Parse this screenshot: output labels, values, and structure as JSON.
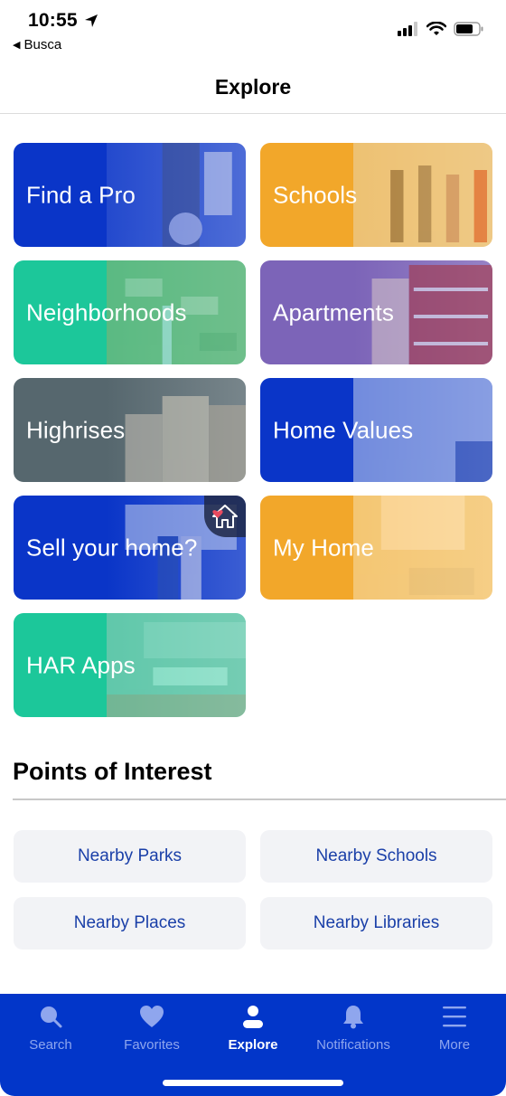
{
  "status_bar": {
    "time": "10:55",
    "back_app": "Busca",
    "icons": [
      "location-arrow-icon",
      "signal-icon",
      "wifi-icon",
      "battery-icon"
    ]
  },
  "header": {
    "title": "Explore"
  },
  "tiles": [
    {
      "label": "Find a Pro",
      "icon": "handshake-image",
      "color": "#0a35c8"
    },
    {
      "label": "Schools",
      "icon": "students-image",
      "color": "#f2a72a"
    },
    {
      "label": "Neighborhoods",
      "icon": "aerial-neighborhood-image",
      "color": "#1cc79a"
    },
    {
      "label": "Apartments",
      "icon": "apartment-building-image",
      "color": "#7c64b8"
    },
    {
      "label": "Highrises",
      "icon": "highrise-building-image",
      "color": "#56676e"
    },
    {
      "label": "Home Values",
      "icon": "paperwork-image",
      "color": "#0a35c8"
    },
    {
      "label": "Sell your home?",
      "icon": "couple-house-image",
      "color": "#0a35c8",
      "badge": "heart-house-icon"
    },
    {
      "label": "My Home",
      "icon": "laptop-calculator-image",
      "color": "#f2a72a"
    },
    {
      "label": "HAR Apps",
      "icon": "laptop-phone-image",
      "color": "#1cc79a"
    }
  ],
  "points_of_interest": {
    "title": "Points of Interest",
    "buttons": [
      {
        "label": "Nearby Parks"
      },
      {
        "label": "Nearby Schools"
      },
      {
        "label": "Nearby Places"
      },
      {
        "label": "Nearby Libraries"
      }
    ]
  },
  "tab_bar": {
    "active": "Explore",
    "color": "#0236c9",
    "tabs": [
      {
        "label": "Search",
        "icon": "search-icon"
      },
      {
        "label": "Favorites",
        "icon": "heart-icon"
      },
      {
        "label": "Explore",
        "icon": "person-icon"
      },
      {
        "label": "Notifications",
        "icon": "bell-icon"
      },
      {
        "label": "More",
        "icon": "menu-icon"
      }
    ]
  }
}
